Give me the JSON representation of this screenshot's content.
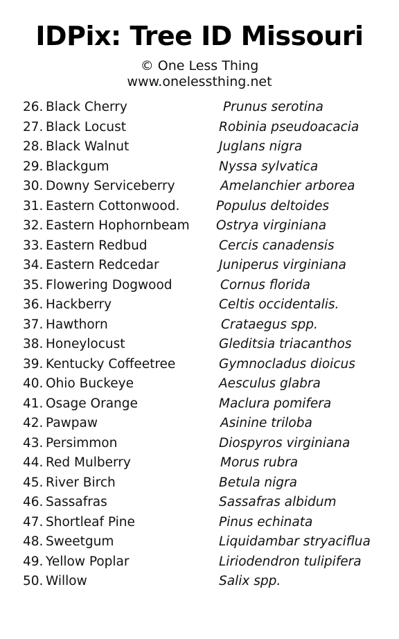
{
  "header": {
    "title": "IDPix: Tree ID Missouri",
    "copyright": "© One Less Thing",
    "website": "www.onelessthing.net"
  },
  "trees": [
    {
      "number": "26.",
      "common": "Black Cherry",
      "scientific": "Prunus serotina"
    },
    {
      "number": "27.",
      "common": "Black Locust",
      "scientific": "Robinia pseudoacacia"
    },
    {
      "number": "28.",
      "common": "Black Walnut",
      "scientific": "Juglans nigra"
    },
    {
      "number": "29.",
      "common": "Blackgum",
      "scientific": "Nyssa sylvatica"
    },
    {
      "number": "30.",
      "common": "Downy Serviceberry",
      "scientific": "Amelanchier arborea"
    },
    {
      "number": "31.",
      "common": "Eastern Cottonwood.",
      "scientific": "Populus deltoides"
    },
    {
      "number": "32.",
      "common": "Eastern Hophornbeam",
      "scientific": "Ostrya virginiana"
    },
    {
      "number": "33.",
      "common": "Eastern Redbud",
      "scientific": "Cercis canadensis"
    },
    {
      "number": "34.",
      "common": "Eastern Redcedar",
      "scientific": "Juniperus virginiana"
    },
    {
      "number": "35.",
      "common": "Flowering Dogwood",
      "scientific": "Cornus florida"
    },
    {
      "number": "36.",
      "common": "Hackberry",
      "scientific": "Celtis occidentalis."
    },
    {
      "number": "37.",
      "common": "Hawthorn",
      "scientific": "Crataegus spp."
    },
    {
      "number": "38.",
      "common": "Honeylocust",
      "scientific": "Gleditsia triacanthos"
    },
    {
      "number": "39.",
      "common": "Kentucky Coffeetree",
      "scientific": "Gymnocladus dioicus"
    },
    {
      "number": "40.",
      "common": "Ohio Buckeye",
      "scientific": "Aesculus glabra"
    },
    {
      "number": "41.",
      "common": "Osage Orange",
      "scientific": "Maclura pomifera"
    },
    {
      "number": "42.",
      "common": "Pawpaw",
      "scientific": "Asinine triloba"
    },
    {
      "number": "43.",
      "common": "Persimmon",
      "scientific": "Diospyros virginiana"
    },
    {
      "number": "44.",
      "common": "Red Mulberry",
      "scientific": "Morus rubra"
    },
    {
      "number": "45.",
      "common": "River Birch",
      "scientific": "Betula nigra"
    },
    {
      "number": "46.",
      "common": "Sassafras",
      "scientific": "Sassafras albidum"
    },
    {
      "number": "47.",
      "common": "Shortleaf Pine",
      "scientific": "Pinus echinata"
    },
    {
      "number": "48.",
      "common": "Sweetgum",
      "scientific": "Liquidambar stryaciflua"
    },
    {
      "number": "49.",
      "common": "Yellow Poplar",
      "scientific": "Liriodendron tulipifera"
    },
    {
      "number": "50.",
      "common": "Willow",
      "scientific": "Salix spp."
    }
  ]
}
